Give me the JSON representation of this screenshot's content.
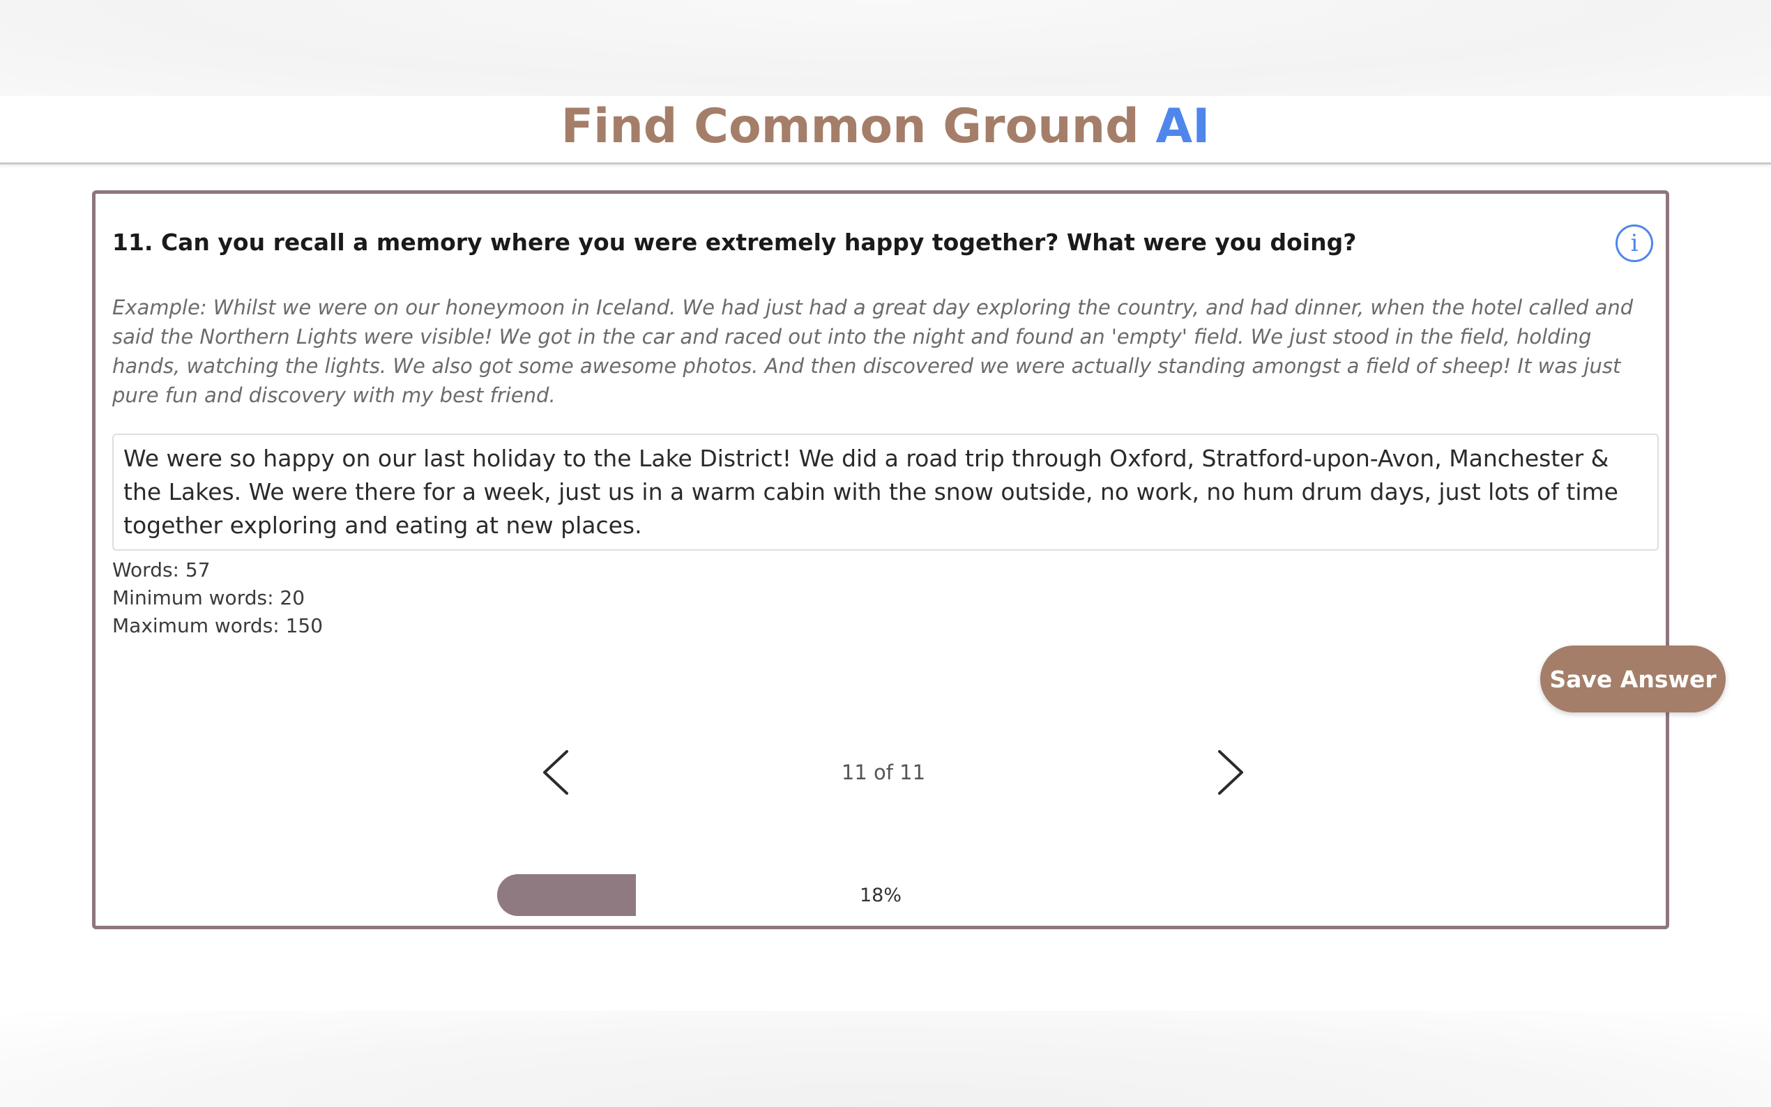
{
  "app": {
    "title_main": "Find Common Ground",
    "title_accent": "AI",
    "brand_color": "#a47e69",
    "accent_color": "#4f86ec"
  },
  "question": {
    "text": "11. Can you recall a memory where you were extremely happy together? What were you doing?",
    "info_icon": "info-icon",
    "info_glyph": "i"
  },
  "example": {
    "text": "Example: Whilst we were on our honeymoon in Iceland. We had just had a great day exploring the country, and had dinner, when the hotel called and said the Northern Lights were visible! We got in the car and raced out into the night and found an 'empty' field. We just stood in the field, holding hands, watching the lights. We also got some awesome photos. And then discovered we were actually standing amongst a field of sheep! It was just pure fun and discovery with my best friend."
  },
  "answer": {
    "value": "We were so happy on our last holiday to the Lake District! We did a road trip through Oxford, Stratford-upon-Avon, Manchester & the Lakes. We were there for a week, just us in a warm cabin with the snow outside, no work, no hum drum days, just lots of time together exploring and eating at new places."
  },
  "stats": {
    "words": "Words: 57",
    "min_words": "Minimum words: 20",
    "max_words": "Maximum words: 150"
  },
  "actions": {
    "save_label": "Save Answer"
  },
  "navigation": {
    "prev_icon": "chevron-left-icon",
    "next_icon": "chevron-right-icon",
    "counter": "11 of 11"
  },
  "progress": {
    "percent": 18,
    "label": "18%",
    "fill_color": "#8e7a80"
  }
}
